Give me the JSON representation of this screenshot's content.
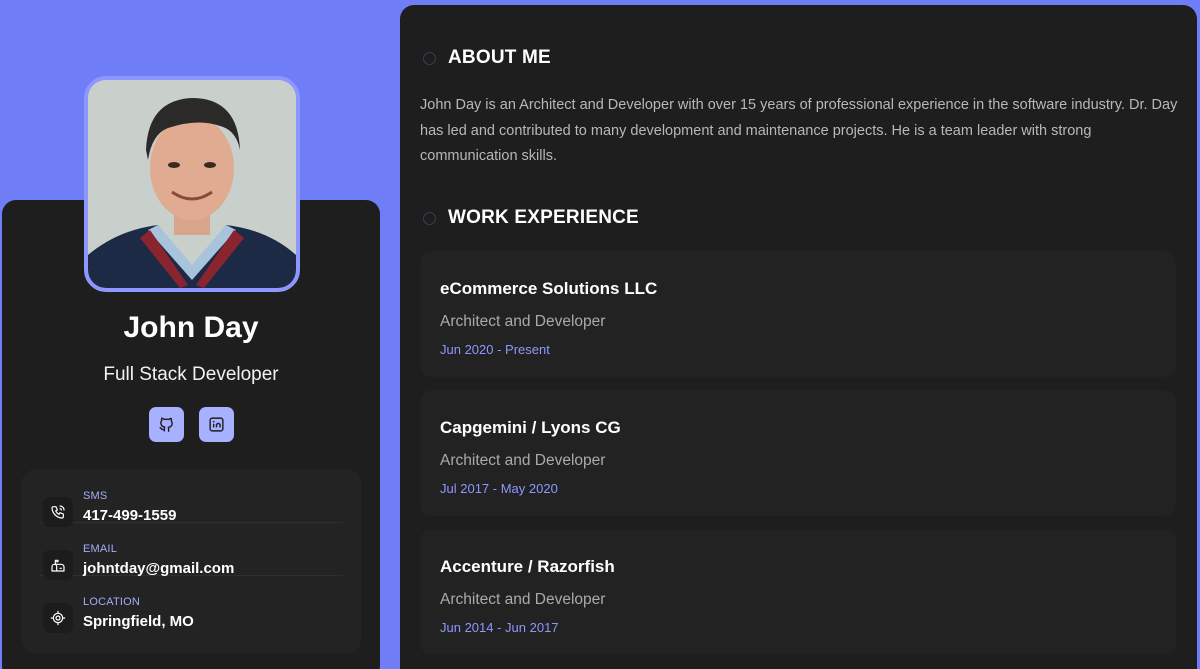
{
  "profile": {
    "name": "John Day",
    "role": "Full Stack Developer"
  },
  "social": [
    {
      "icon": "github-icon"
    },
    {
      "icon": "linkedin-icon"
    }
  ],
  "contacts": [
    {
      "label": "SMS",
      "value": "417-499-1559",
      "icon": "phone-icon"
    },
    {
      "label": "EMAIL",
      "value": "johntday@gmail.com",
      "icon": "mailbox-icon"
    },
    {
      "label": "LOCATION",
      "value": "Springfield, MO",
      "icon": "location-icon"
    }
  ],
  "about": {
    "title": "ABOUT ME",
    "text": "John Day is an Architect and Developer with over 15 years of professional experience in the software industry. Dr. Day has led and contributed to many development and maintenance projects. He is a team leader with strong communication skills."
  },
  "experience": {
    "title": "WORK EXPERIENCE",
    "jobs": [
      {
        "company": "eCommerce Solutions LLC",
        "title": "Architect and Developer",
        "dates": "Jun 2020 - Present"
      },
      {
        "company": "Capgemini / Lyons CG",
        "title": "Architect and Developer",
        "dates": "Jul 2017 - May 2020"
      },
      {
        "company": "Accenture / Razorfish",
        "title": "Architect and Developer",
        "dates": "Jun 2014 - Jun 2017"
      }
    ]
  },
  "colors": {
    "background": "#6f7ef6",
    "accent": "#8d97ff",
    "card": "#1e1e1f"
  }
}
